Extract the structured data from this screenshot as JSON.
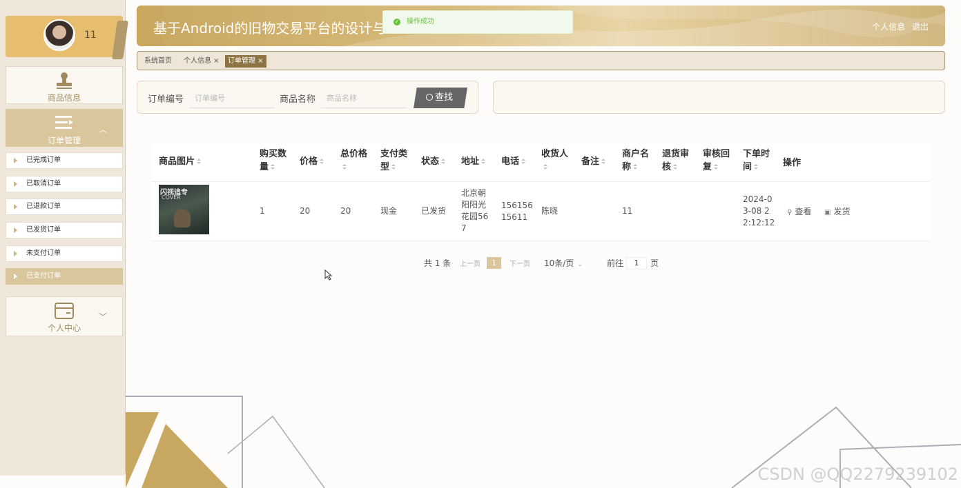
{
  "app": {
    "title": "基于Android的旧物交易平台的设计与",
    "user_links": [
      "个人信息",
      "退出"
    ]
  },
  "toast": {
    "text": "操作成功",
    "type": "success"
  },
  "user": {
    "name": "11"
  },
  "sidebar": {
    "goods_label": "商品信息",
    "orders_label": "订单管理",
    "order_items": [
      {
        "label": "已完成订单"
      },
      {
        "label": "已取消订单"
      },
      {
        "label": "已退款订单"
      },
      {
        "label": "已发货订单"
      },
      {
        "label": "未支付订单"
      },
      {
        "label": "已支付订单",
        "active": true
      }
    ],
    "user_center_label": "个人中心"
  },
  "tabs": [
    {
      "label": "系统首页"
    },
    {
      "label": "个人信息 ×"
    },
    {
      "label": "订单管理 ×",
      "active": true
    }
  ],
  "search": {
    "order_no_label": "订单编号",
    "order_no_placeholder": "订单编号",
    "goods_name_label": "商品名称",
    "goods_name_placeholder": "商品名称",
    "button_label": "查找"
  },
  "table": {
    "headers": [
      "商品图片",
      "购买数\n量",
      "价格",
      "总价格",
      "支付类\n型",
      "状态",
      "地址",
      "电话",
      "收货人",
      "备注",
      "商户名\n称",
      "退货审\n核",
      "审核回\n复",
      "下单时\n间",
      "操作"
    ],
    "rows": [
      {
        "image_title": "闪视追专",
        "image_subtitle": "COVER",
        "quantity": "1",
        "price": "20",
        "total": "20",
        "pay_type": "现金",
        "status": "已发货",
        "address": "北京朝\n阳阳光\n花园56\n7",
        "phone": "156156\n15611",
        "receiver": "陈晓",
        "remark": "",
        "merchant": "11",
        "return_review": "",
        "review_reply": "",
        "order_time": "2024-0\n3-08 2\n2:12:12",
        "actions": [
          "查看",
          "发货"
        ]
      }
    ]
  },
  "pagination": {
    "total_text": "共 1 条",
    "prev": "上一页",
    "current_page": "1",
    "next": "下一页",
    "page_size": "10条/页",
    "goto_label": "前往",
    "goto_value": "1",
    "page_unit": "页"
  },
  "watermark": "CSDN @QQ2279239102",
  "colors": {
    "accent": "#d9c69c",
    "header": "#c9a75f",
    "success": "#67c23a"
  }
}
